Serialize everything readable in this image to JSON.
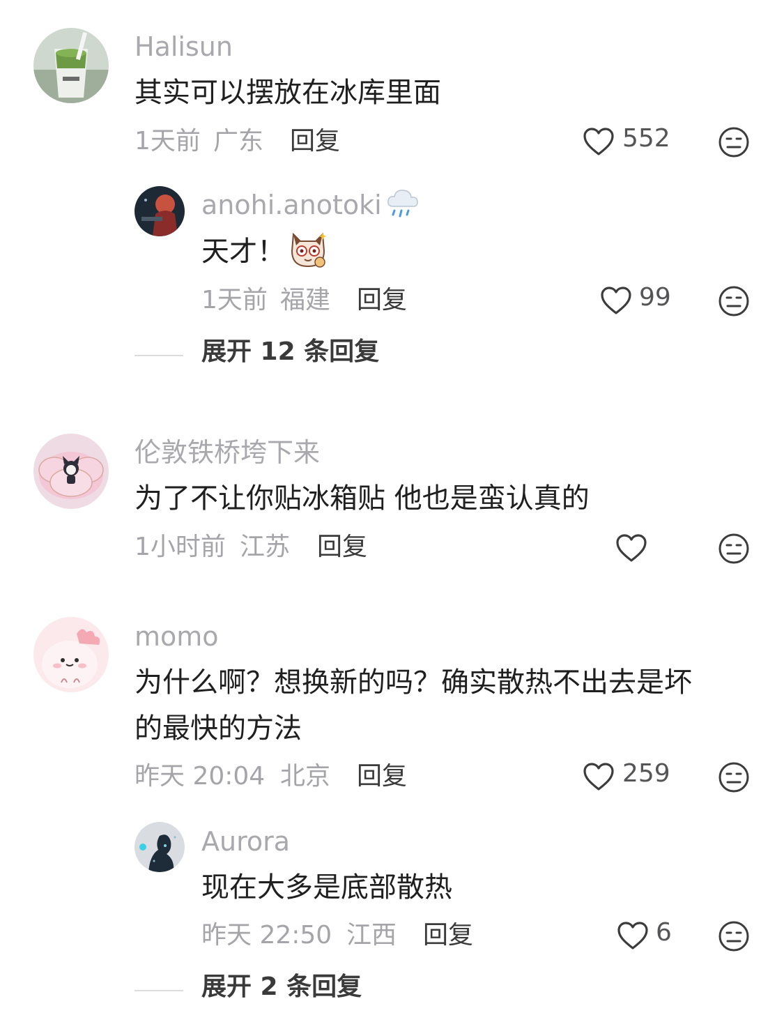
{
  "comments": [
    {
      "username": "Halisun",
      "text": "其实可以摆放在冰库里面",
      "time": "1天前",
      "location": "广东",
      "reply_label": "回复",
      "likes": "552"
    },
    {
      "username": "anohi.anotoki",
      "text": "天才！",
      "time": "1天前",
      "location": "福建",
      "reply_label": "回复",
      "likes": "99"
    },
    {
      "username": "伦敦铁桥垮下来",
      "text": "为了不让你贴冰箱贴 他也是蛮认真的",
      "time": "1小时前",
      "location": "江苏",
      "reply_label": "回复",
      "likes": ""
    },
    {
      "username": "momo",
      "text_line1": "为什么啊？想换新的吗？确实散热不出去是坏",
      "text_line2": "的最快的方法",
      "time": "昨天 20:04",
      "location": "北京",
      "reply_label": "回复",
      "likes": "259"
    },
    {
      "username": "Aurora",
      "text": "现在大多是底部散热",
      "time": "昨天 22:50",
      "location": "江西",
      "reply_label": "回复",
      "likes": "6"
    }
  ],
  "expand": [
    {
      "label": "展开 12 条回复"
    },
    {
      "label": "展开 2 条回复"
    }
  ],
  "icons": {
    "like": "heart-outline-icon",
    "dislike": "neutral-face-icon",
    "weather": "rain-cloud-icon"
  }
}
